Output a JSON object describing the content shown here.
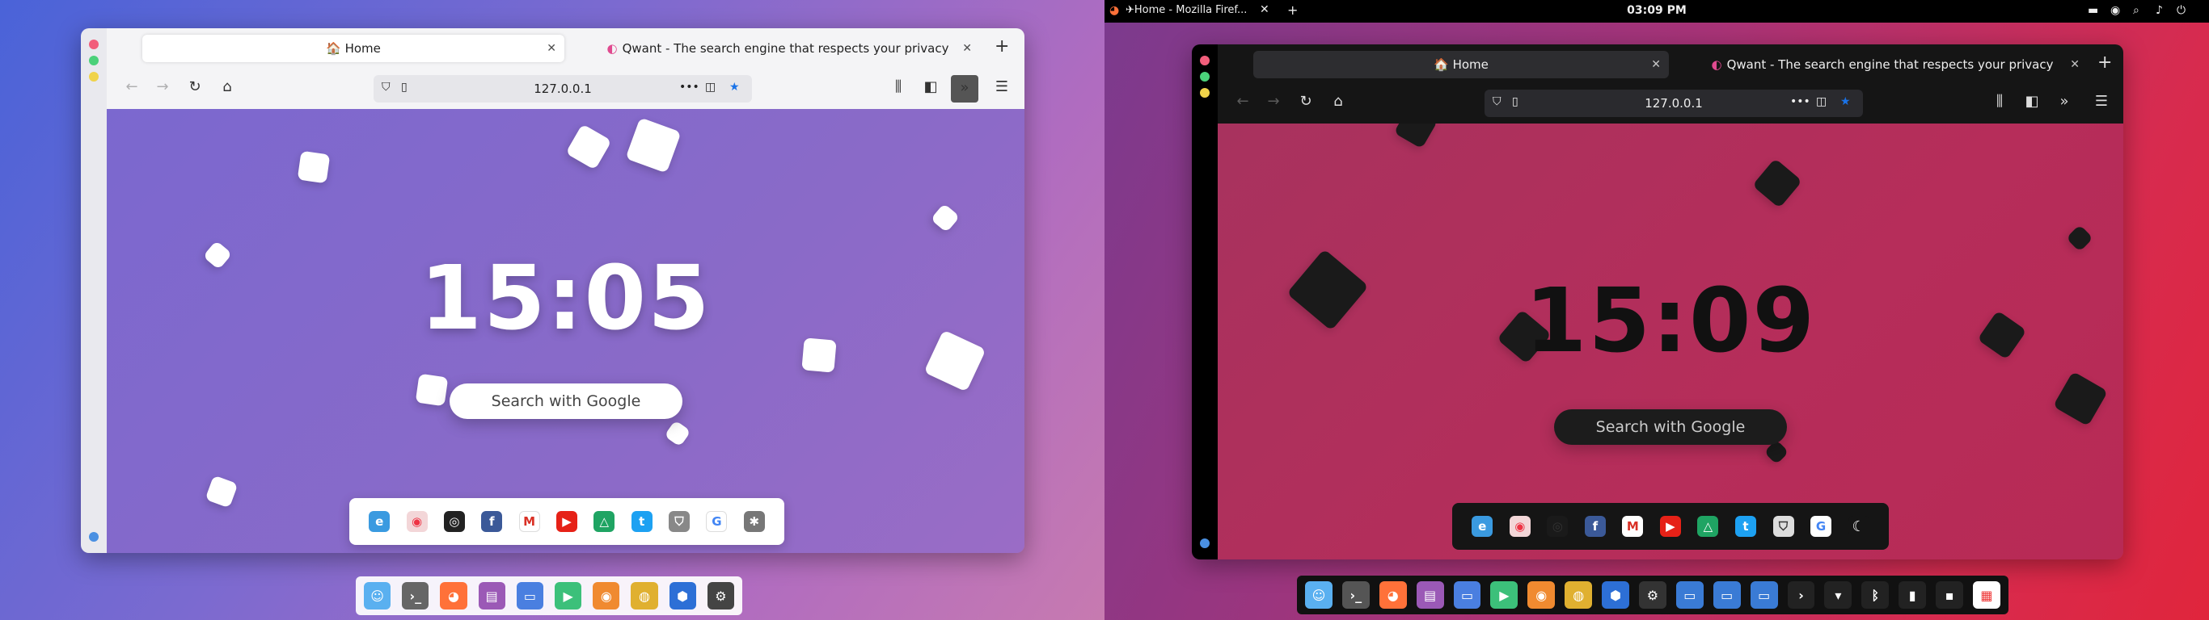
{
  "left": {
    "tabs": [
      {
        "label": "🏠 Home"
      },
      {
        "label": "Qwant - The search engine that respects your privacy"
      }
    ],
    "url": "127.0.0.1",
    "clock": "15:05",
    "search_label": "Search with Google",
    "dock_icons": [
      "edge-icon",
      "pocket-icon",
      "github-icon",
      "facebook-icon",
      "gmail-icon",
      "youtube-icon",
      "drive-icon",
      "twitter-icon",
      "shield-icon",
      "google-icon",
      "settings-icon"
    ],
    "taskbar_icons": [
      "finder-icon",
      "terminal-icon",
      "firefox-icon",
      "editor-icon",
      "files-icon",
      "media-icon",
      "game-icon",
      "color-icon",
      "box-icon",
      "settings-icon"
    ]
  },
  "right": {
    "window_title": "Home - Mozilla Firef...",
    "time": "03:09 PM",
    "tabs": [
      {
        "label": "🏠 Home"
      },
      {
        "label": "Qwant - The search engine that respects your privacy"
      }
    ],
    "url": "127.0.0.1",
    "clock": "15:09",
    "search_label": "Search with Google",
    "dock_icons": [
      "edge-icon",
      "pocket-icon",
      "github-icon",
      "facebook-icon",
      "gmail-icon",
      "youtube-icon",
      "drive-icon",
      "twitter-icon",
      "shield-icon",
      "google-icon",
      "moon-icon"
    ],
    "taskbar_icons": [
      "finder-icon",
      "terminal-icon",
      "firefox-icon",
      "editor-icon",
      "files-icon",
      "media-icon",
      "game-icon",
      "color-icon",
      "box-icon",
      "settings-icon",
      "folder-icon",
      "folder-icon",
      "folder-icon",
      "chevron-icon",
      "wifi-icon",
      "bluetooth-icon",
      "battery-icon",
      "clipboard-icon",
      "calendar-icon"
    ]
  },
  "colors": {
    "accent": "#1a73e8",
    "left_content": "#7b68cf",
    "right_content": "#b62d5a"
  }
}
